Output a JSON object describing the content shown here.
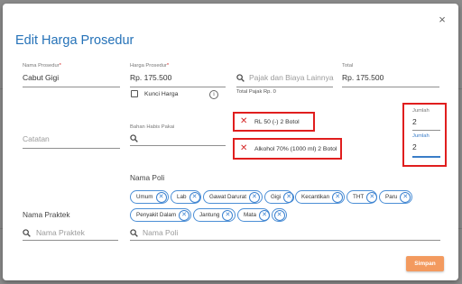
{
  "dialog": {
    "title": "Edit Harga Prosedur",
    "close_icon": "×"
  },
  "form": {
    "nama_prosedur": {
      "label": "Nama Prosedur",
      "required_mark": "*",
      "value": "Cabut Gigi"
    },
    "harga_prosedur": {
      "label": "Harga Prosedur",
      "required_mark": "*",
      "value": "Rp. 175.500"
    },
    "pajak": {
      "placeholder": "Pajak dan Biaya Lainnya",
      "total_pajak": "Total Pajak Rp. 0"
    },
    "total": {
      "label": "Total",
      "value": "Rp. 175.500"
    },
    "kunci_harga": {
      "label": "Kunci Harga",
      "checked": false
    },
    "info_icon": "i",
    "catatan": {
      "placeholder": "Catatan"
    },
    "bahan": {
      "label": "Bahan Habis Pakai",
      "items": [
        {
          "text": "RL 50 (-) 2 Botol"
        },
        {
          "text": "Alkohol 70% (1000 ml) 2 Botol"
        }
      ]
    },
    "jumlah": [
      {
        "label": "Jumlah",
        "value": "2"
      },
      {
        "label": "Jumlah",
        "value": "2"
      }
    ],
    "nama_poli": {
      "label": "Nama Poli",
      "chips": [
        "Umum",
        "Lab",
        "Gawat Darurat",
        "Gigi",
        "Kecantikan",
        "THT",
        "Paru",
        "Penyakit Dalam",
        "Jantung",
        "Mata"
      ],
      "search_placeholder": "Nama Poli"
    },
    "nama_praktek": {
      "label": "Nama Praktek",
      "placeholder": "Nama Praktek"
    }
  },
  "actions": {
    "save_label": "Simpan"
  },
  "colors": {
    "title": "#2572b8",
    "highlight": "#e01e1e",
    "chip_border": "#4c8fd6",
    "save_button": "#f39a5f"
  },
  "icons": {
    "search": "search-icon",
    "close": "close-icon",
    "remove": "close-circle-icon",
    "info": "info-icon"
  }
}
